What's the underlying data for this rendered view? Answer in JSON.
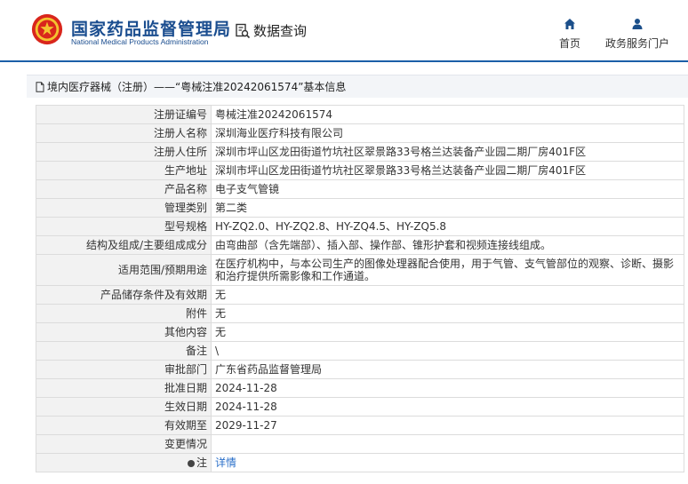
{
  "header": {
    "title_cn": "国家药品监督管理局",
    "title_en": "National Medical Products Administration",
    "query_label": "数据查询",
    "nav": [
      {
        "label": "首页",
        "icon": "home-icon"
      },
      {
        "label": "政务服务门户",
        "icon": "user-icon"
      }
    ]
  },
  "breadcrumb": "境内医疗器械（注册）——“粤械注准20242061574”基本信息",
  "colors": {
    "accent": "#1b5fa8",
    "link": "#2a6fc9",
    "label_bg": "#f2f2f2"
  },
  "rows": [
    {
      "label": "注册证编号",
      "value": "粤械注准20242061574"
    },
    {
      "label": "注册人名称",
      "value": "深圳海业医疗科技有限公司"
    },
    {
      "label": "注册人住所",
      "value": "深圳市坪山区龙田街道竹坑社区翠景路33号格兰达装备产业园二期厂房401F区"
    },
    {
      "label": "生产地址",
      "value": "深圳市坪山区龙田街道竹坑社区翠景路33号格兰达装备产业园二期厂房401F区"
    },
    {
      "label": "产品名称",
      "value": "电子支气管镜"
    },
    {
      "label": "管理类别",
      "value": "第二类"
    },
    {
      "label": "型号规格",
      "value": "HY-ZQ2.0、HY-ZQ2.8、HY-ZQ4.5、HY-ZQ5.8"
    },
    {
      "label": "结构及组成/主要组成成分",
      "value": "由弯曲部（含先端部）、插入部、操作部、锥形护套和视频连接线组成。"
    },
    {
      "label": "适用范围/预期用途",
      "value": "在医疗机构中，与本公司生产的图像处理器配合使用，用于气管、支气管部位的观察、诊断、摄影和治疗提供所需影像和工作通道。"
    },
    {
      "label": "产品储存条件及有效期",
      "value": "无"
    },
    {
      "label": "附件",
      "value": "无"
    },
    {
      "label": "其他内容",
      "value": "无"
    },
    {
      "label": "备注",
      "value": "\\"
    },
    {
      "label": "审批部门",
      "value": "广东省药品监督管理局"
    },
    {
      "label": "批准日期",
      "value": "2024-11-28"
    },
    {
      "label": "生效日期",
      "value": "2024-11-28"
    },
    {
      "label": "有效期至",
      "value": "2029-11-27"
    },
    {
      "label": "变更情况",
      "value": ""
    }
  ],
  "note": {
    "label": "注",
    "link_text": "详情"
  }
}
